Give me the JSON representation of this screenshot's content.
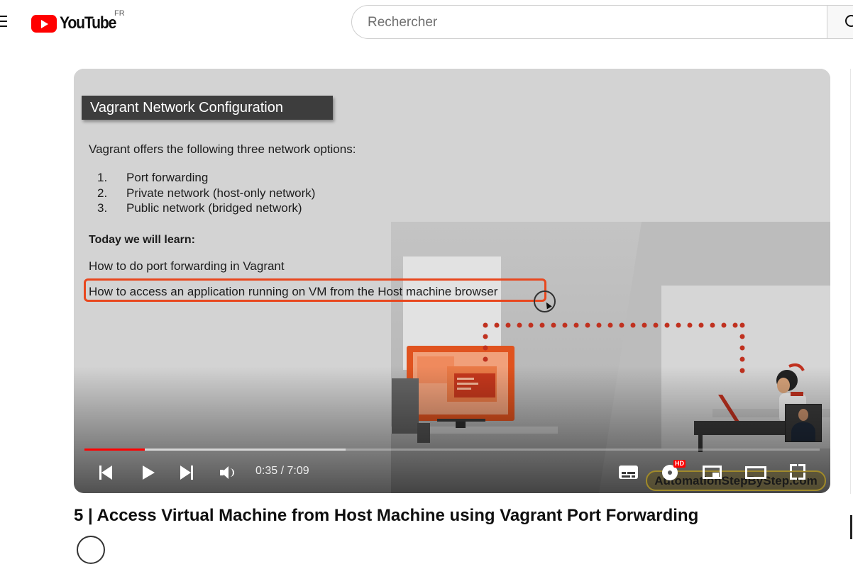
{
  "header": {
    "logo_text": "YouTube",
    "country_code": "FR",
    "search": {
      "placeholder": "Rechercher",
      "value": ""
    }
  },
  "player": {
    "slide": {
      "title": "Vagrant Network Configuration",
      "intro": "Vagrant offers the following three network options:",
      "options": [
        {
          "num": "1.",
          "label": "Port forwarding"
        },
        {
          "num": "2.",
          "label": "Private network (host-only network)"
        },
        {
          "num": "3.",
          "label": "Public network (bridged network)"
        }
      ],
      "learn_heading": "Today we will learn:",
      "learn_items": [
        "How to do port forwarding in Vagrant",
        "How to access an application running on VM from the Host machine browser"
      ]
    },
    "watermark": "AutomationStepByStep.com",
    "time_current": "0:35",
    "time_separator": " / ",
    "time_total": "7:09",
    "progress_fraction": 0.0816,
    "buffered_fraction": 0.355,
    "quality_badge": "HD",
    "colors": {
      "progress": "#ff0000",
      "highlight": "#e8471e",
      "monitor": "#e0531f",
      "dots": "#c0311f"
    }
  },
  "video": {
    "title": "5 | Access Virtual Machine from Host Machine using Vagrant Port Forwarding"
  }
}
